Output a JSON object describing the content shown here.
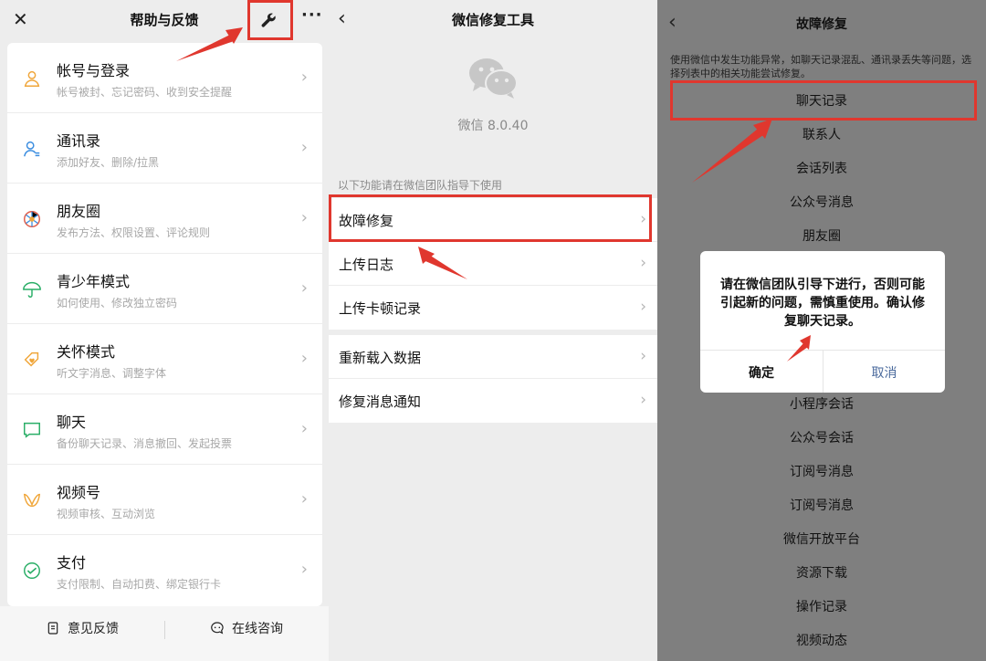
{
  "panel1": {
    "title": "帮助与反馈",
    "close_glyph": "✕",
    "more_glyph": "···",
    "chevron_glyph": "›",
    "items": [
      {
        "title": "帐号与登录",
        "subtitle": "帐号被封、忘记密码、收到安全提醒",
        "icon": "person-icon",
        "color": "#f0a63a"
      },
      {
        "title": "通讯录",
        "subtitle": "添加好友、删除/拉黑",
        "icon": "contacts-icon",
        "color": "#3b8de0"
      },
      {
        "title": "朋友圈",
        "subtitle": "发布方法、权限设置、评论规则",
        "icon": "moments-icon",
        "color": "#e05d4a"
      },
      {
        "title": "青少年模式",
        "subtitle": "如何使用、修改独立密码",
        "icon": "umbrella-icon",
        "color": "#2aae67"
      },
      {
        "title": "关怀模式",
        "subtitle": "听文字消息、调整字体",
        "icon": "heart-tag-icon",
        "color": "#f0a63a"
      },
      {
        "title": "聊天",
        "subtitle": "备份聊天记录、消息撤回、发起投票",
        "icon": "chat-icon",
        "color": "#2aae67"
      },
      {
        "title": "视频号",
        "subtitle": "视频审核、互动浏览",
        "icon": "channels-icon",
        "color": "#f0a63a"
      },
      {
        "title": "支付",
        "subtitle": "支付限制、自动扣费、绑定银行卡",
        "icon": "pay-icon",
        "color": "#2aae67"
      }
    ],
    "feedback_label": "意见反馈",
    "consult_label": "在线咨询"
  },
  "panel2": {
    "title": "微信修复工具",
    "back_glyph": "‹",
    "version": "微信 8.0.40",
    "hint": "以下功能请在微信团队指导下使用",
    "group1": [
      "故障修复",
      "上传日志",
      "上传卡顿记录"
    ],
    "group2": [
      "重新载入数据",
      "修复消息通知"
    ]
  },
  "panel3": {
    "title": "故障修复",
    "back_glyph": "‹",
    "description": "使用微信中发生功能异常，如聊天记录混乱、通讯录丢失等问题，选择列表中的相关功能尝试修复。",
    "options_top": [
      "聊天记录",
      "联系人",
      "会话列表",
      "公众号消息",
      "朋友圈"
    ],
    "options_bottom": [
      "小程序会话",
      "公众号会话",
      "订阅号消息",
      "订阅号消息",
      "微信开放平台",
      "资源下载",
      "操作记录",
      "视频动态"
    ],
    "dialog": {
      "message": "请在微信团队引导下进行，否则可能引起新的问题，需慎重使用。确认修复聊天记录。",
      "confirm": "确定",
      "cancel": "取消"
    }
  },
  "colors": {
    "highlight": "#e0372e",
    "wechat_logo": "#c7c7c7",
    "cancel_link": "#4a6a9c"
  }
}
